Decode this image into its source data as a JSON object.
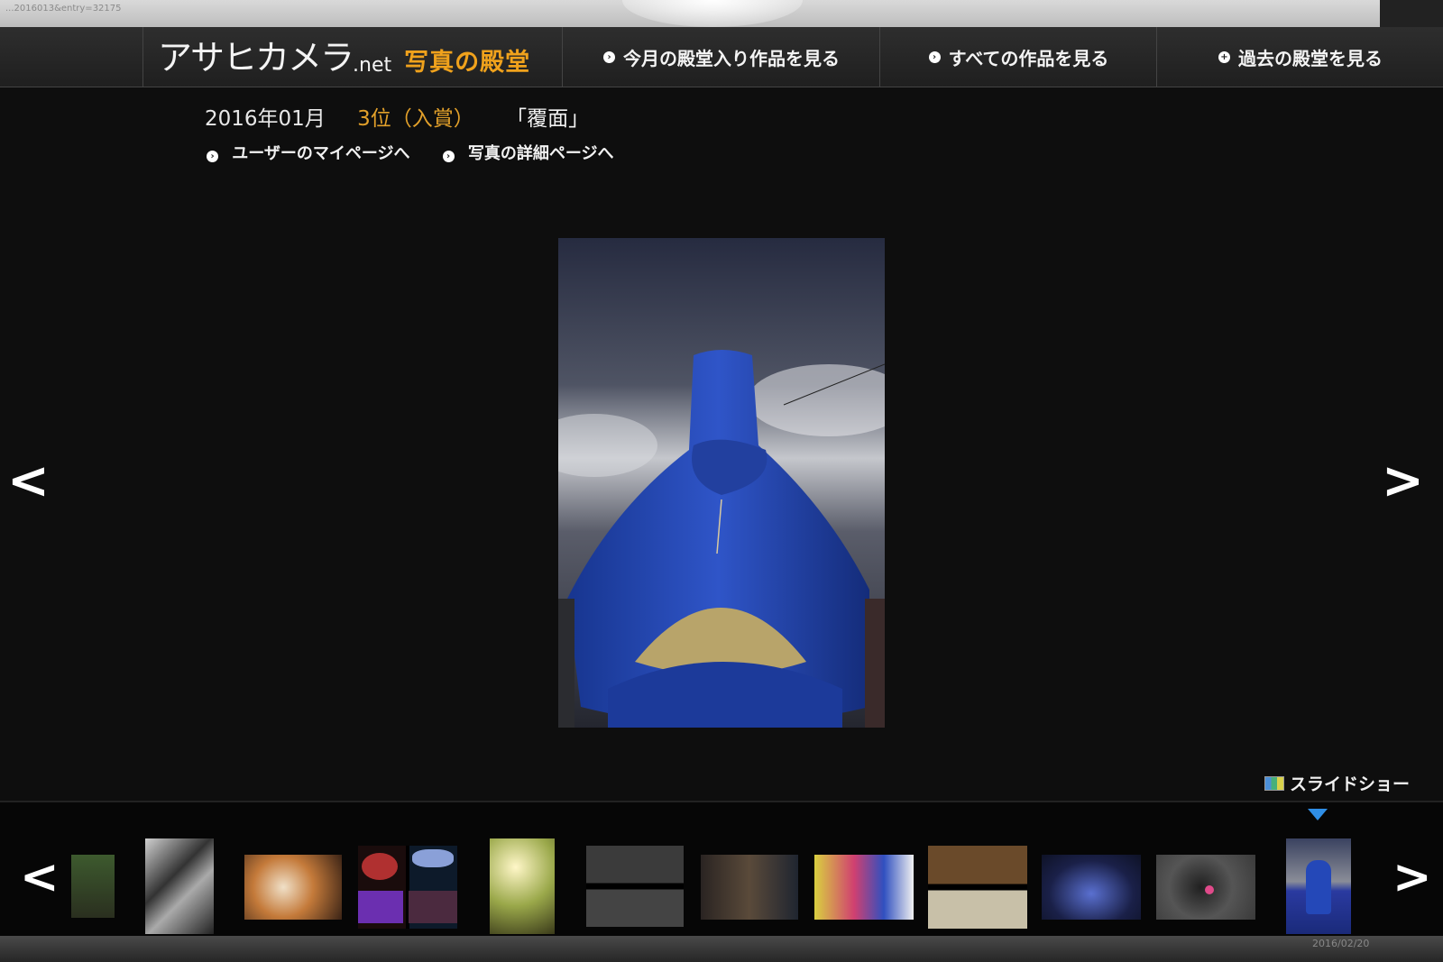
{
  "browser": {
    "url_fragment": "...2016013&entry=32175"
  },
  "header": {
    "logo_main": "アサヒカメラ",
    "logo_net": ".net",
    "logo_sub": "写真の殿堂",
    "nav": [
      {
        "label": "今月の殿堂入り作品を見る"
      },
      {
        "label": "すべての作品を見る"
      },
      {
        "label": "過去の殿堂を見る"
      }
    ]
  },
  "entry": {
    "date": "2016年01月",
    "rank": "3位（入賞）",
    "title": "「覆面」",
    "links": {
      "mypage": "ユーザーのマイページへ",
      "detail": "写真の詳細ページへ"
    }
  },
  "controls": {
    "prev": "<",
    "next": ">",
    "slideshow": "スライドショー"
  },
  "filmstrip": {
    "prev": "<",
    "next": ">",
    "thumbnails_count": 13,
    "selected_index": 12
  },
  "screen": {
    "timestamp": "2016/02/20"
  }
}
